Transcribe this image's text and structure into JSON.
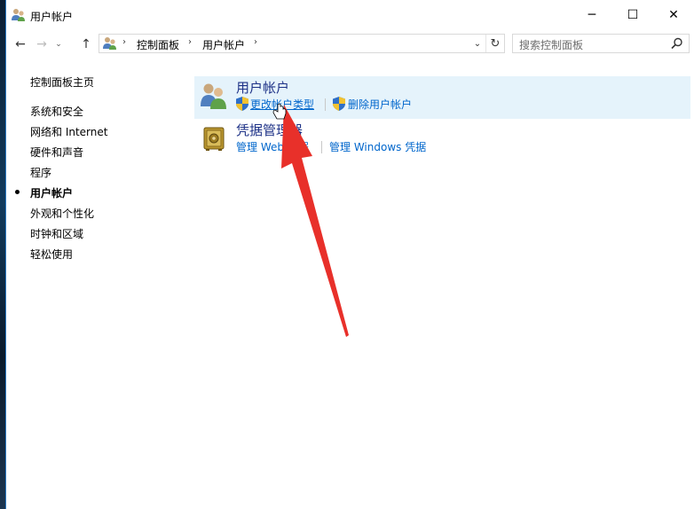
{
  "window": {
    "title": "用户帐户",
    "controls": {
      "minimize": "─",
      "maximize": "☐",
      "close": "✕"
    }
  },
  "nav": {
    "back": "←",
    "forward": "→",
    "recent": "⌄",
    "up": "↑"
  },
  "breadcrumbs": [
    "控制面板",
    "用户帐户"
  ],
  "breadcrumb_sep": "›",
  "addr_dropdown": "⌄",
  "refresh": "↻",
  "search": {
    "placeholder": "搜索控制面板"
  },
  "sidebar": {
    "home": "控制面板主页",
    "items": [
      {
        "label": "系统和安全",
        "current": false
      },
      {
        "label": "网络和 Internet",
        "current": false
      },
      {
        "label": "硬件和声音",
        "current": false
      },
      {
        "label": "程序",
        "current": false
      },
      {
        "label": "用户帐户",
        "current": true
      },
      {
        "label": "外观和个性化",
        "current": false
      },
      {
        "label": "时钟和区域",
        "current": false
      },
      {
        "label": "轻松使用",
        "current": false
      }
    ]
  },
  "categories": [
    {
      "title": "用户帐户",
      "icon": "users-icon",
      "links": [
        {
          "label": "更改帐户类型",
          "shield": true
        },
        {
          "label": "删除用户帐户",
          "shield": true
        }
      ]
    },
    {
      "title": "凭据管理器",
      "icon": "vault-icon",
      "links": [
        {
          "label": "管理 Web 凭据",
          "shield": false
        },
        {
          "label": "管理 Windows 凭据",
          "shield": false
        }
      ]
    }
  ],
  "colors": {
    "accent_link": "#0066cc",
    "category_title": "#1e3287",
    "selected_bg": "#e5f3fb",
    "annotation_arrow": "#e8302a"
  }
}
